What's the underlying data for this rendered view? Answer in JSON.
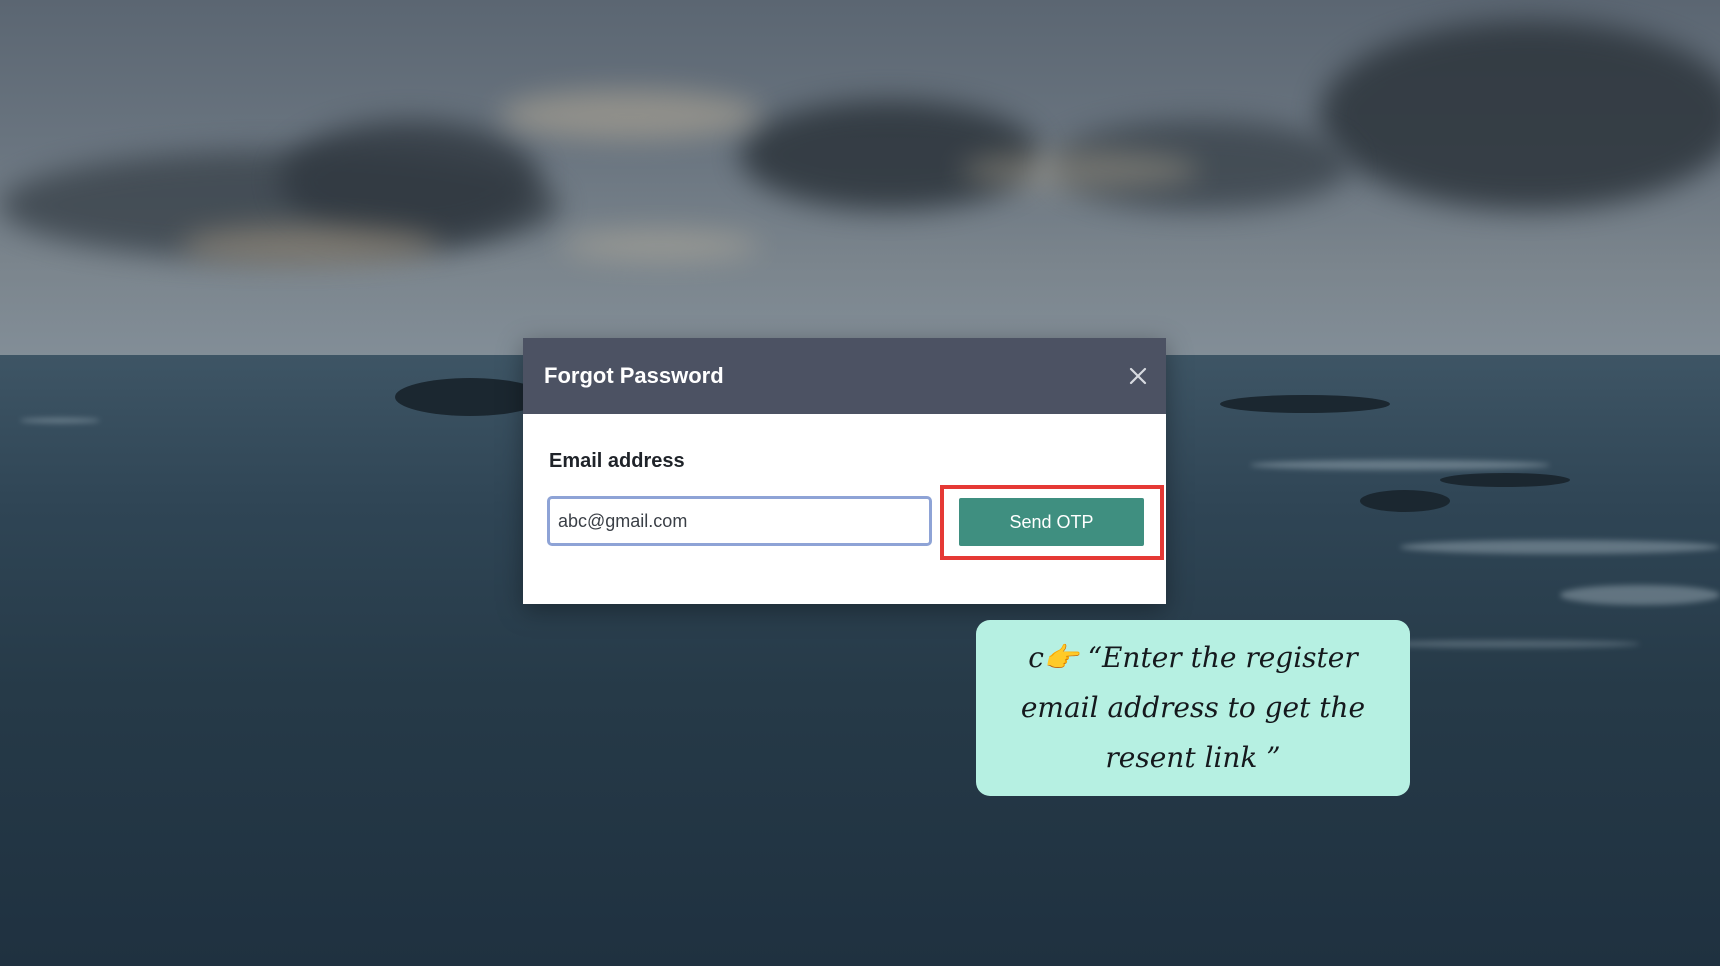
{
  "dialog": {
    "title": "Forgot Password",
    "close_icon": "close-icon",
    "email_label": "Email address",
    "email_value": "abc@gmail.com",
    "send_button_label": "Send OTP"
  },
  "annotation": {
    "text": "c👉 “Enter the register email address to get the resent link ”",
    "highlight_color": "#e53935",
    "background_color": "#b6f0e2"
  },
  "colors": {
    "header_bg": "#4c5263",
    "button_bg": "#3f8f80",
    "input_border": "#8ea3d6"
  }
}
